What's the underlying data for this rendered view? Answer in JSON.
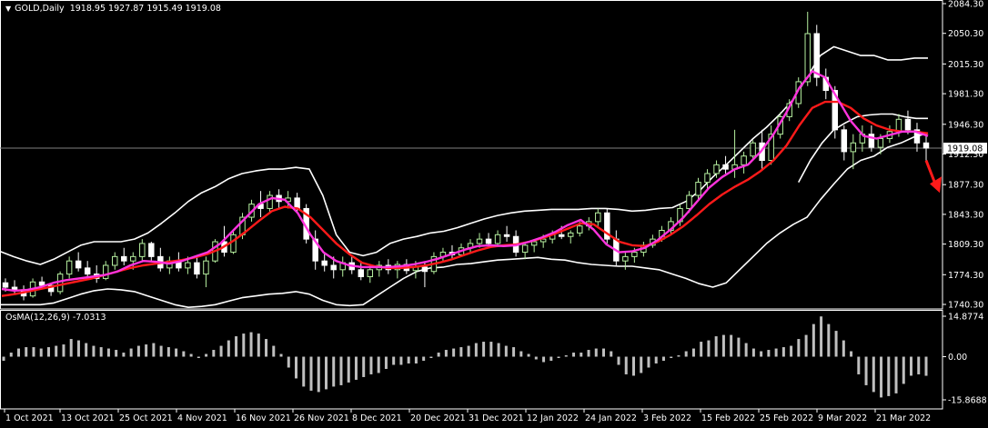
{
  "header": {
    "symbol": "GOLD,Daily",
    "ohlc": "1918.95 1927.87 1915.49 1919.08",
    "triangle_icon": "caret-down-icon"
  },
  "osma_header": "OsMA(12,26,9) -7.0313",
  "current_price_label": "1919.08",
  "colors": {
    "background": "#000000",
    "bull_candle": "#b6f0a0",
    "bear_candle": "#ffffff",
    "bollinger": "#ffffff",
    "fast_ma": "#ff33dd",
    "slow_ma": "#ff1a1a",
    "osma_bars": "#bfbfbf",
    "arrow": "#ff1a1a",
    "grid_line": "#7f7f7f"
  },
  "chart_data": [
    {
      "type": "line",
      "panel": "price",
      "x_labels": [
        "1 Oct 2021",
        "13 Oct 2021",
        "25 Oct 2021",
        "4 Nov 2021",
        "16 Nov 2021",
        "26 Nov 2021",
        "8 Dec 2021",
        "20 Dec 2021",
        "31 Dec 2021",
        "12 Jan 2022",
        "24 Jan 2022",
        "3 Feb 2022",
        "15 Feb 2022",
        "25 Feb 2022",
        "9 Mar 2022",
        "21 Mar 2022"
      ],
      "y_ticks": [
        2084.3,
        2050.3,
        2015.3,
        1981.3,
        1946.3,
        1912.3,
        1877.3,
        1843.3,
        1809.3,
        1774.3,
        1740.3
      ],
      "ylim": [
        1740.3,
        2084.3
      ],
      "current_price": 1919.08,
      "candles": [
        [
          1765,
          1770,
          1755,
          1760
        ],
        [
          1760,
          1768,
          1752,
          1757
        ],
        [
          1757,
          1762,
          1745,
          1750
        ],
        [
          1750,
          1770,
          1748,
          1766
        ],
        [
          1766,
          1772,
          1758,
          1762
        ],
        [
          1762,
          1765,
          1750,
          1755
        ],
        [
          1755,
          1778,
          1752,
          1775
        ],
        [
          1775,
          1795,
          1770,
          1790
        ],
        [
          1790,
          1800,
          1778,
          1782
        ],
        [
          1782,
          1790,
          1770,
          1775
        ],
        [
          1775,
          1785,
          1765,
          1770
        ],
        [
          1770,
          1790,
          1768,
          1785
        ],
        [
          1785,
          1800,
          1780,
          1795
        ],
        [
          1795,
          1805,
          1785,
          1790
        ],
        [
          1790,
          1800,
          1780,
          1795
        ],
        [
          1795,
          1815,
          1790,
          1810
        ],
        [
          1810,
          1812,
          1790,
          1795
        ],
        [
          1795,
          1805,
          1778,
          1782
        ],
        [
          1782,
          1795,
          1775,
          1790
        ],
        [
          1790,
          1800,
          1778,
          1782
        ],
        [
          1782,
          1795,
          1775,
          1788
        ],
        [
          1788,
          1795,
          1770,
          1775
        ],
        [
          1775,
          1795,
          1760,
          1790
        ],
        [
          1790,
          1815,
          1788,
          1812
        ],
        [
          1812,
          1830,
          1795,
          1800
        ],
        [
          1800,
          1825,
          1798,
          1820
        ],
        [
          1820,
          1845,
          1815,
          1840
        ],
        [
          1840,
          1860,
          1835,
          1855
        ],
        [
          1855,
          1870,
          1840,
          1850
        ],
        [
          1850,
          1870,
          1845,
          1865
        ],
        [
          1865,
          1872,
          1850,
          1858
        ],
        [
          1858,
          1870,
          1850,
          1862
        ],
        [
          1862,
          1868,
          1845,
          1850
        ],
        [
          1850,
          1855,
          1810,
          1815
        ],
        [
          1815,
          1825,
          1780,
          1790
        ],
        [
          1790,
          1800,
          1778,
          1785
        ],
        [
          1785,
          1795,
          1770,
          1780
        ],
        [
          1780,
          1795,
          1772,
          1788
        ],
        [
          1788,
          1795,
          1775,
          1780
        ],
        [
          1780,
          1790,
          1768,
          1772
        ],
        [
          1772,
          1785,
          1765,
          1780
        ],
        [
          1780,
          1790,
          1772,
          1785
        ],
        [
          1785,
          1792,
          1775,
          1780
        ],
        [
          1780,
          1790,
          1770,
          1786
        ],
        [
          1786,
          1792,
          1775,
          1779
        ],
        [
          1779,
          1790,
          1770,
          1783
        ],
        [
          1783,
          1788,
          1760,
          1778
        ],
        [
          1778,
          1800,
          1775,
          1795
        ],
        [
          1795,
          1805,
          1790,
          1800
        ],
        [
          1800,
          1808,
          1792,
          1797
        ],
        [
          1797,
          1810,
          1795,
          1805
        ],
        [
          1805,
          1815,
          1800,
          1810
        ],
        [
          1810,
          1822,
          1805,
          1815
        ],
        [
          1815,
          1822,
          1805,
          1810
        ],
        [
          1810,
          1825,
          1808,
          1820
        ],
        [
          1820,
          1830,
          1812,
          1818
        ],
        [
          1818,
          1825,
          1795,
          1800
        ],
        [
          1800,
          1812,
          1792,
          1808
        ],
        [
          1808,
          1815,
          1800,
          1812
        ],
        [
          1812,
          1820,
          1805,
          1815
        ],
        [
          1815,
          1825,
          1810,
          1820
        ],
        [
          1820,
          1830,
          1815,
          1818
        ],
        [
          1818,
          1825,
          1810,
          1822
        ],
        [
          1822,
          1835,
          1818,
          1830
        ],
        [
          1830,
          1840,
          1825,
          1835
        ],
        [
          1835,
          1850,
          1830,
          1845
        ],
        [
          1845,
          1850,
          1810,
          1815
        ],
        [
          1815,
          1825,
          1785,
          1790
        ],
        [
          1790,
          1800,
          1780,
          1795
        ],
        [
          1795,
          1805,
          1788,
          1800
        ],
        [
          1800,
          1812,
          1795,
          1808
        ],
        [
          1808,
          1820,
          1805,
          1815
        ],
        [
          1815,
          1830,
          1812,
          1825
        ],
        [
          1825,
          1840,
          1820,
          1835
        ],
        [
          1835,
          1855,
          1830,
          1850
        ],
        [
          1850,
          1870,
          1845,
          1865
        ],
        [
          1865,
          1885,
          1860,
          1880
        ],
        [
          1880,
          1895,
          1870,
          1890
        ],
        [
          1890,
          1905,
          1885,
          1900
        ],
        [
          1900,
          1910,
          1890,
          1895
        ],
        [
          1895,
          1940,
          1885,
          1900
        ],
        [
          1900,
          1915,
          1890,
          1910
        ],
        [
          1910,
          1928,
          1905,
          1925
        ],
        [
          1925,
          1940,
          1895,
          1905
        ],
        [
          1905,
          1945,
          1900,
          1935
        ],
        [
          1935,
          1960,
          1930,
          1955
        ],
        [
          1955,
          1975,
          1950,
          1970
        ],
        [
          1970,
          2000,
          1965,
          1995
        ],
        [
          1995,
          2075,
          1990,
          2050
        ],
        [
          2050,
          2060,
          1990,
          2000
        ],
        [
          2000,
          2010,
          1975,
          1985
        ],
        [
          1985,
          1990,
          1930,
          1940
        ],
        [
          1940,
          1945,
          1905,
          1915
        ],
        [
          1915,
          1935,
          1895,
          1925
        ],
        [
          1925,
          1945,
          1915,
          1935
        ],
        [
          1935,
          1945,
          1915,
          1920
        ],
        [
          1920,
          1935,
          1912,
          1930
        ],
        [
          1930,
          1945,
          1925,
          1938
        ],
        [
          1938,
          1958,
          1932,
          1952
        ],
        [
          1952,
          1962,
          1935,
          1940
        ],
        [
          1940,
          1948,
          1915,
          1925
        ],
        [
          1925,
          1935,
          1905,
          1919.08
        ]
      ],
      "fast_ma": [
        1758,
        1756,
        1757,
        1760,
        1765,
        1768,
        1770,
        1772,
        1774,
        1778,
        1785,
        1790,
        1789,
        1787,
        1790,
        1795,
        1800,
        1810,
        1825,
        1840,
        1855,
        1862,
        1860,
        1845,
        1820,
        1800,
        1790,
        1785,
        1783,
        1783,
        1783,
        1784,
        1786,
        1789,
        1793,
        1798,
        1803,
        1807,
        1808,
        1807,
        1808,
        1812,
        1817,
        1823,
        1831,
        1837,
        1826,
        1809,
        1800,
        1801,
        1805,
        1814,
        1826,
        1840,
        1857,
        1874,
        1886,
        1895,
        1900,
        1915,
        1935,
        1960,
        1988,
        2007,
        2000,
        1975,
        1950,
        1933,
        1930,
        1934,
        1938,
        1938,
        1933
      ],
      "slow_ma": [
        1750,
        1752,
        1755,
        1758,
        1761,
        1764,
        1767,
        1770,
        1774,
        1778,
        1782,
        1785,
        1787,
        1789,
        1791,
        1794,
        1798,
        1804,
        1813,
        1824,
        1836,
        1847,
        1852,
        1850,
        1840,
        1825,
        1810,
        1798,
        1788,
        1784,
        1782,
        1782,
        1783,
        1785,
        1788,
        1792,
        1797,
        1802,
        1806,
        1808,
        1809,
        1812,
        1816,
        1821,
        1827,
        1833,
        1832,
        1822,
        1812,
        1808,
        1807,
        1812,
        1820,
        1830,
        1842,
        1855,
        1866,
        1875,
        1883,
        1893,
        1905,
        1922,
        1945,
        1965,
        1972,
        1972,
        1965,
        1953,
        1945,
        1940,
        1938,
        1938,
        1936
      ],
      "boll_upper": [
        1801,
        1795,
        1790,
        1786,
        1792,
        1800,
        1808,
        1812,
        1812,
        1812,
        1815,
        1822,
        1833,
        1845,
        1858,
        1868,
        1875,
        1884,
        1890,
        1893,
        1895,
        1895,
        1897,
        1895,
        1865,
        1820,
        1800,
        1796,
        1800,
        1810,
        1815,
        1818,
        1822,
        1824,
        1828,
        1833,
        1838,
        1842,
        1845,
        1847,
        1848,
        1849,
        1849,
        1849,
        1850,
        1850,
        1849,
        1847,
        1848,
        1850,
        1851,
        1858,
        1870,
        1886,
        1900,
        1915,
        1930,
        1943,
        1958,
        1975,
        2000,
        2025,
        2035,
        2030,
        2025,
        2025,
        2020,
        2020,
        2022,
        2022
      ],
      "boll_lower": [
        1740,
        1740,
        1740,
        1740,
        1742,
        1747,
        1752,
        1756,
        1758,
        1757,
        1755,
        1750,
        1745,
        1740,
        1737,
        1738,
        1740,
        1744,
        1748,
        1750,
        1752,
        1753,
        1755,
        1752,
        1745,
        1740,
        1739,
        1740,
        1750,
        1760,
        1770,
        1778,
        1782,
        1783,
        1786,
        1787,
        1789,
        1791,
        1792,
        1793,
        1794,
        1792,
        1791,
        1788,
        1786,
        1785,
        1784,
        1784,
        1782,
        1780,
        1775,
        1770,
        1764,
        1760,
        1765,
        1780,
        1795,
        1810,
        1822,
        1832,
        1840,
        1860,
        1878,
        1895,
        1905,
        1910,
        1920,
        1925,
        1932,
        1936
      ],
      "boll_middle_from_index": 87,
      "boll_middle": [
        1880,
        1905,
        1925,
        1940,
        1948,
        1955,
        1957,
        1958,
        1958,
        1955,
        1953,
        1953
      ]
    },
    {
      "type": "bar",
      "panel": "oscillator",
      "title": "OsMA(12,26,9) -7.0313",
      "y_ticks": [
        14.8774,
        0.0,
        -15.8688
      ],
      "ylim": [
        -15.8688,
        14.8774
      ],
      "values": [
        -1.5,
        1.5,
        3.0,
        3.5,
        3.5,
        3.0,
        3.5,
        4.0,
        4.5,
        6.5,
        6.0,
        5.0,
        4.0,
        3.5,
        3.0,
        2.5,
        1.5,
        3.0,
        4.0,
        4.5,
        5.0,
        4.0,
        3.5,
        3.0,
        2.0,
        1.0,
        -0.5,
        1.0,
        2.5,
        4.0,
        6.0,
        7.5,
        8.5,
        9.0,
        8.5,
        6.5,
        4.0,
        1.0,
        -4.0,
        -8.0,
        -11.0,
        -12.5,
        -13.0,
        -12.0,
        -11.0,
        -10.5,
        -9.5,
        -8.5,
        -7.5,
        -6.5,
        -6.0,
        -4.5,
        -3.0,
        -3.0,
        -2.5,
        -2.5,
        -1.5,
        -0.5,
        1.5,
        2.5,
        3.0,
        3.5,
        4.0,
        5.0,
        5.5,
        5.5,
        5.0,
        4.0,
        3.5,
        2.0,
        1.0,
        -1.0,
        -2.0,
        -1.5,
        -0.5,
        0.5,
        1.5,
        1.5,
        2.5,
        3.0,
        3.0,
        2.0,
        -3.0,
        -6.5,
        -7.0,
        -6.0,
        -4.0,
        -2.5,
        -1.5,
        -0.5,
        0.5,
        2.0,
        3.0,
        5.5,
        6.0,
        7.5,
        8.0,
        8.0,
        7.0,
        5.0,
        3.0,
        2.0,
        2.5,
        3.0,
        3.5,
        4.0,
        6.5,
        8.0,
        12.0,
        14.8,
        12.0,
        9.5,
        6.0,
        2.0,
        -6.5,
        -10.5,
        -13.0,
        -15.0,
        -14.5,
        -13.5,
        -10.0,
        -7.0,
        -6.5,
        -7.0313
      ]
    }
  ]
}
